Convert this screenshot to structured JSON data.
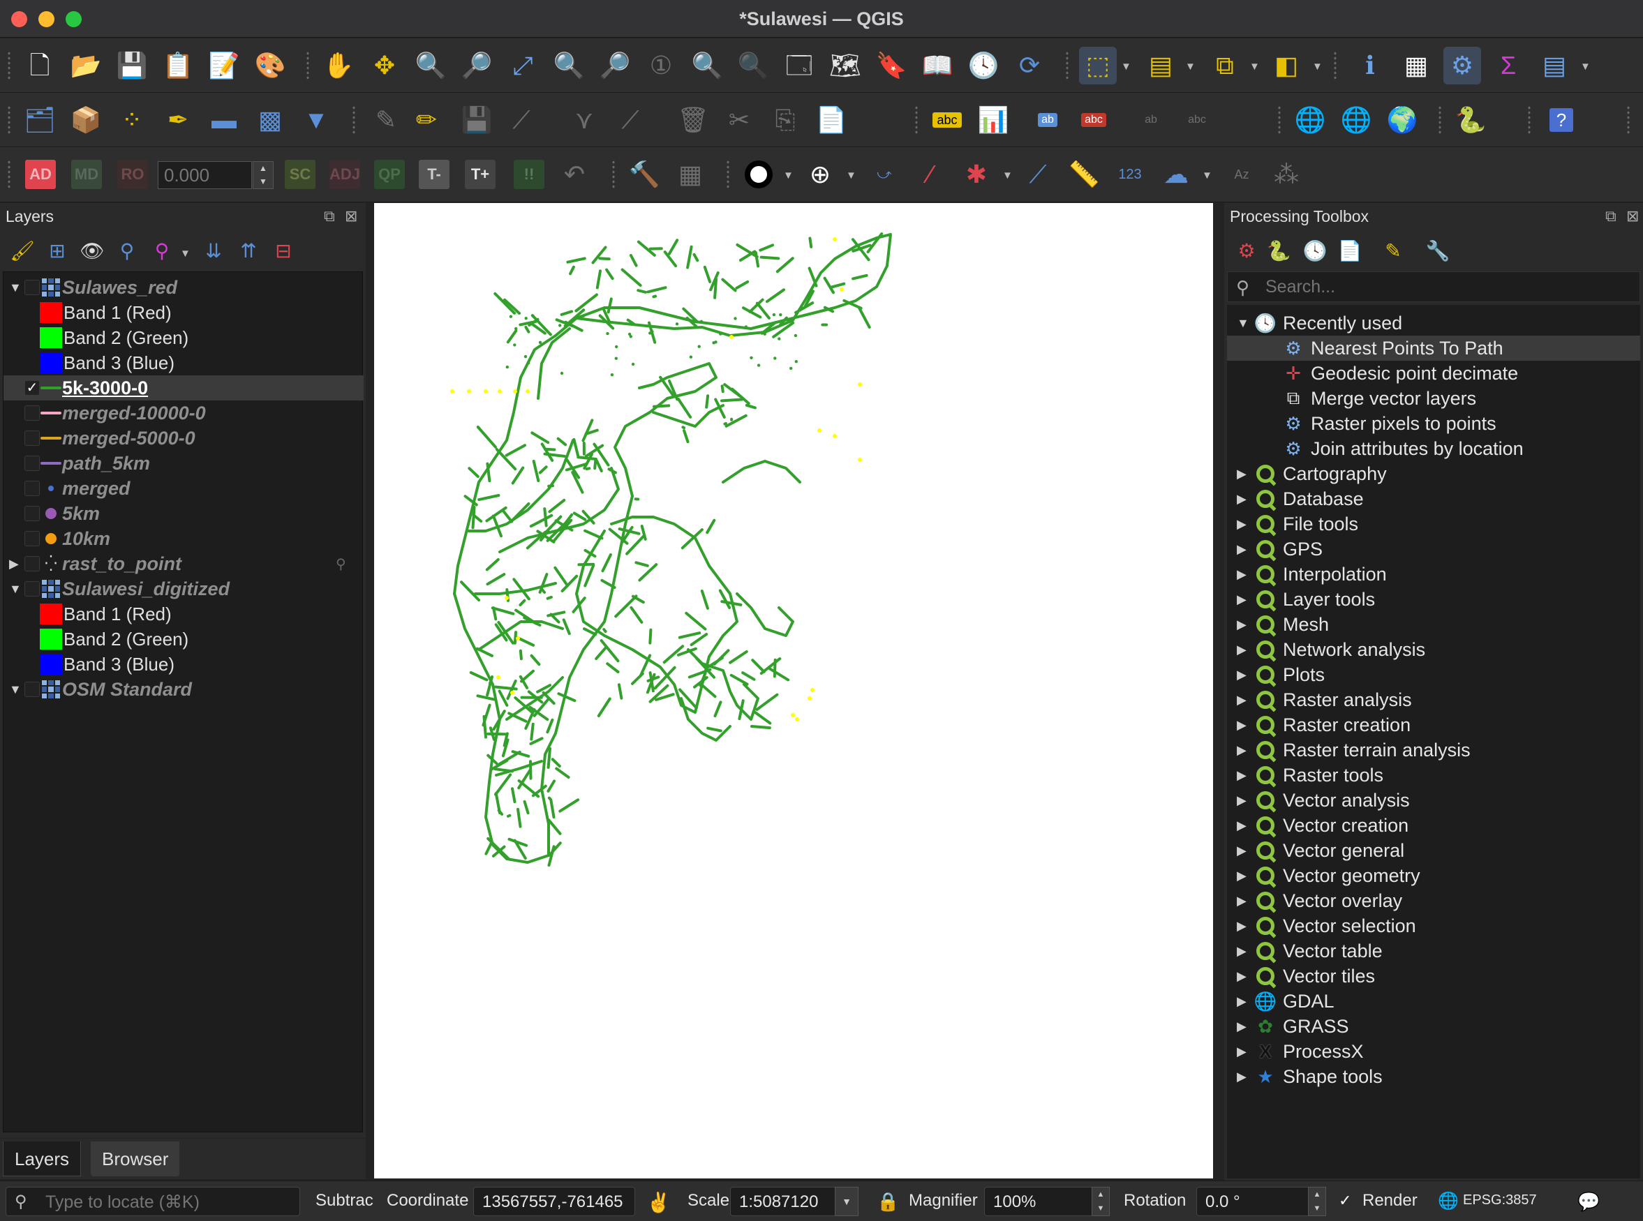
{
  "window": {
    "title": "*Sulawesi — QGIS"
  },
  "layers_panel": {
    "title": "Layers",
    "items": [
      {
        "type": "group",
        "name": "Sulawes_red",
        "checked": false,
        "expanded": true
      },
      {
        "type": "band",
        "name": "Band 1 (Red)",
        "color": "#ff0000"
      },
      {
        "type": "band",
        "name": "Band 2 (Green)",
        "color": "#00ff00"
      },
      {
        "type": "band",
        "name": "Band 3 (Blue)",
        "color": "#0000ff"
      },
      {
        "type": "line",
        "name": "5k-3000-0",
        "checked": true,
        "selected": true,
        "color": "#33a02c"
      },
      {
        "type": "line",
        "name": "merged-10000-0",
        "checked": false,
        "color": "#f4a6c8"
      },
      {
        "type": "line",
        "name": "merged-5000-0",
        "checked": false,
        "color": "#d9a521"
      },
      {
        "type": "line",
        "name": "path_5km",
        "checked": false,
        "color": "#8e6bbf"
      },
      {
        "type": "point",
        "name": "merged",
        "checked": false,
        "color": "#4a6fd1",
        "size": "small"
      },
      {
        "type": "point",
        "name": "5km",
        "checked": false,
        "color": "#9b59b6",
        "size": "large"
      },
      {
        "type": "point",
        "name": "10km",
        "checked": false,
        "color": "#f39c12",
        "size": "large"
      },
      {
        "type": "multipoint",
        "name": "rast_to_point",
        "checked": false,
        "expanded": false
      },
      {
        "type": "group",
        "name": "Sulawesi_digitized",
        "checked": false,
        "expanded": true
      },
      {
        "type": "band",
        "name": "Band 1 (Red)",
        "color": "#ff0000"
      },
      {
        "type": "band",
        "name": "Band 2 (Green)",
        "color": "#00ff00"
      },
      {
        "type": "band",
        "name": "Band 3 (Blue)",
        "color": "#0000ff"
      },
      {
        "type": "group",
        "name": "OSM Standard",
        "checked": false,
        "expanded": true
      }
    ],
    "tabs": [
      "Layers",
      "Browser"
    ]
  },
  "toolbox": {
    "title": "Processing Toolbox",
    "search_placeholder": "Search...",
    "recently_used_label": "Recently used",
    "recent": [
      {
        "label": "Nearest Points To Path",
        "icon": "gear-icon",
        "selected": true
      },
      {
        "label": "Geodesic point decimate",
        "icon": "decimate-icon"
      },
      {
        "label": "Merge vector layers",
        "icon": "merge-icon"
      },
      {
        "label": "Raster pixels to points",
        "icon": "gear-icon"
      },
      {
        "label": "Join attributes by location",
        "icon": "gear-icon"
      }
    ],
    "providers": [
      {
        "label": "Cartography",
        "icon": "qgis-icon"
      },
      {
        "label": "Database",
        "icon": "qgis-icon"
      },
      {
        "label": "File tools",
        "icon": "qgis-icon"
      },
      {
        "label": "GPS",
        "icon": "qgis-icon"
      },
      {
        "label": "Interpolation",
        "icon": "qgis-icon"
      },
      {
        "label": "Layer tools",
        "icon": "qgis-icon"
      },
      {
        "label": "Mesh",
        "icon": "qgis-icon"
      },
      {
        "label": "Network analysis",
        "icon": "qgis-icon"
      },
      {
        "label": "Plots",
        "icon": "qgis-icon"
      },
      {
        "label": "Raster analysis",
        "icon": "qgis-icon"
      },
      {
        "label": "Raster creation",
        "icon": "qgis-icon"
      },
      {
        "label": "Raster terrain analysis",
        "icon": "qgis-icon"
      },
      {
        "label": "Raster tools",
        "icon": "qgis-icon"
      },
      {
        "label": "Vector analysis",
        "icon": "qgis-icon"
      },
      {
        "label": "Vector creation",
        "icon": "qgis-icon"
      },
      {
        "label": "Vector general",
        "icon": "qgis-icon"
      },
      {
        "label": "Vector geometry",
        "icon": "qgis-icon"
      },
      {
        "label": "Vector overlay",
        "icon": "qgis-icon"
      },
      {
        "label": "Vector selection",
        "icon": "qgis-icon"
      },
      {
        "label": "Vector table",
        "icon": "qgis-icon"
      },
      {
        "label": "Vector tiles",
        "icon": "qgis-icon"
      },
      {
        "label": "GDAL",
        "icon": "gdal-icon"
      },
      {
        "label": "GRASS",
        "icon": "grass-icon"
      },
      {
        "label": "ProcessX",
        "icon": "processx-icon"
      },
      {
        "label": "Shape tools",
        "icon": "star-icon"
      }
    ]
  },
  "advanced_digitizing": {
    "buttons": [
      "AD",
      "MD",
      "RO",
      "SC",
      "ADJ",
      "QP",
      "T-",
      "T+",
      "!!"
    ],
    "value": "0.000"
  },
  "statusbar": {
    "locator_placeholder": "Type to locate (⌘K)",
    "subtract_label": "Subtrac",
    "coordinate_label": "Coordinate",
    "coordinate_value": "13567557,-761465",
    "scale_label": "Scale",
    "scale_value": "1:5087120",
    "magnifier_label": "Magnifier",
    "magnifier_value": "100%",
    "rotation_label": "Rotation",
    "rotation_value": "0.0 °",
    "render_label": "Render",
    "render_checked": true,
    "crs": "EPSG:3857"
  },
  "colors": {
    "network_line": "#33a02c",
    "points": "#ffff00",
    "background": "#232323",
    "map_background": "#ffffff"
  }
}
